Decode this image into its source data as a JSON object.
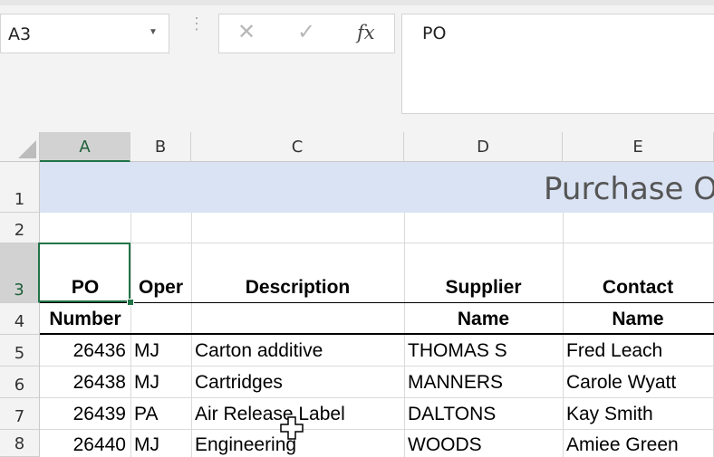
{
  "namebox": {
    "value": "A3",
    "arrow_icon": "chevron-down-icon"
  },
  "formula_bar": {
    "cancel_icon": "close-icon",
    "enter_icon": "checkmark-icon",
    "fx_label": "fx",
    "value": "PO"
  },
  "columns": [
    "A",
    "B",
    "C",
    "D",
    "E"
  ],
  "rows": [
    "1",
    "2",
    "3",
    "4",
    "5",
    "6",
    "7",
    "8"
  ],
  "selected_cell": "A3",
  "title": "Purchase O",
  "headers": {
    "row3": [
      "PO",
      "Oper",
      "Description",
      "Supplier",
      "Contact"
    ],
    "row4": [
      "Number",
      "",
      "",
      "Name",
      "Name"
    ]
  },
  "data_rows": [
    {
      "po": "26436",
      "oper": "MJ",
      "description": "Carton additive",
      "supplier": "THOMAS S",
      "contact": "Fred Leach"
    },
    {
      "po": "26438",
      "oper": "MJ",
      "description": "Cartridges",
      "supplier": "MANNERS",
      "contact": "Carole Wyatt"
    },
    {
      "po": "26439",
      "oper": "PA",
      "description": "Air Release Label",
      "supplier": "DALTONS",
      "contact": "Kay Smith"
    },
    {
      "po": "26440",
      "oper": "MJ",
      "description": "Engineering",
      "supplier": "WOODS",
      "contact": "Amiee Green"
    }
  ],
  "colors": {
    "accent": "#217346",
    "banner": "#dae3f3"
  }
}
